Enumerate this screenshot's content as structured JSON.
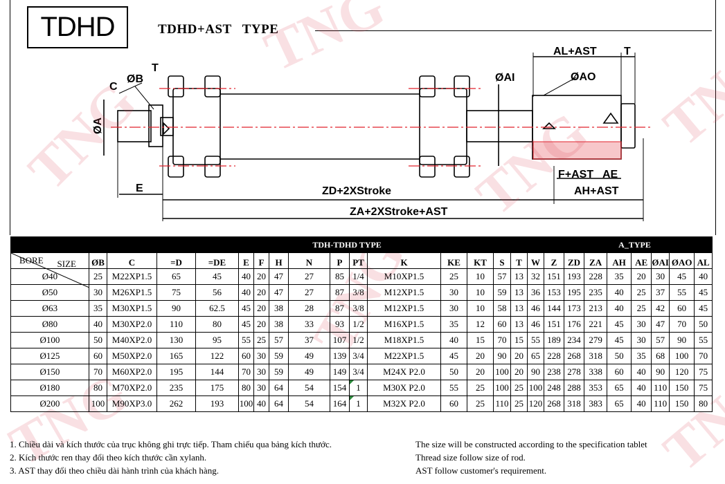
{
  "header": {
    "logo_text": "TDHD",
    "type_title": "TDHD+AST   TYPE"
  },
  "watermark": {
    "text": "TNG",
    "color": "#dc3c50"
  },
  "drawing": {
    "labels": {
      "c": "C",
      "ob": "ØB",
      "t_left": "T",
      "oa": "ØA",
      "e": "E",
      "oai": "ØAI",
      "ao": "ØAO",
      "al_ast": "AL+AST",
      "t_right": "T",
      "f_ast": "F+AST",
      "ae": "AE",
      "ah_ast": "AH+AST",
      "zd": "ZD+2XStroke",
      "za": "ZA+2XStroke+AST"
    },
    "colors": {
      "centerline": "#e0202a",
      "hatch": "#e0202a",
      "outline": "#000000"
    }
  },
  "table": {
    "title": "TDH-TDHD TYPE",
    "right_title": "A_TYPE",
    "corner_size": "SIZE",
    "corner_bore": "BORE",
    "columns": [
      "ØB",
      "C",
      "=D",
      "=DE",
      "E",
      "F",
      "H",
      "N",
      "P",
      "PT",
      "K",
      "KE",
      "KT",
      "S",
      "T",
      "W",
      "Z",
      "ZD",
      "ZA",
      "AH",
      "AE",
      "ØAI",
      "ØAO",
      "AL"
    ],
    "rows": [
      {
        "bore": "Ø40",
        "cells": [
          "25",
          "M22XP1.5",
          "65",
          "45",
          "40",
          "20",
          "47",
          "27",
          "85",
          "1/4",
          "M10XP1.5",
          "25",
          "10",
          "57",
          "13",
          "32",
          "151",
          "193",
          "228",
          "35",
          "20",
          "30",
          "45",
          "40"
        ]
      },
      {
        "bore": "Ø50",
        "cells": [
          "30",
          "M26XP1.5",
          "75",
          "56",
          "40",
          "20",
          "47",
          "27",
          "87",
          "3/8",
          "M12XP1.5",
          "30",
          "10",
          "59",
          "13",
          "36",
          "153",
          "195",
          "235",
          "40",
          "25",
          "37",
          "55",
          "45"
        ]
      },
      {
        "bore": "Ø63",
        "cells": [
          "35",
          "M30XP1.5",
          "90",
          "62.5",
          "45",
          "20",
          "38",
          "28",
          "87",
          "3/8",
          "M12XP1.5",
          "30",
          "10",
          "58",
          "13",
          "46",
          "144",
          "173",
          "213",
          "40",
          "25",
          "42",
          "60",
          "45"
        ]
      },
      {
        "bore": "Ø80",
        "cells": [
          "40",
          "M30XP2.0",
          "110",
          "80",
          "45",
          "20",
          "38",
          "33",
          "93",
          "1/2",
          "M16XP1.5",
          "35",
          "12",
          "60",
          "13",
          "46",
          "151",
          "176",
          "221",
          "45",
          "30",
          "47",
          "70",
          "50"
        ]
      },
      {
        "bore": "Ø100",
        "cells": [
          "50",
          "M40XP2.0",
          "130",
          "95",
          "55",
          "25",
          "57",
          "37",
          "107",
          "1/2",
          "M18XP1.5",
          "40",
          "15",
          "70",
          "15",
          "55",
          "189",
          "234",
          "279",
          "45",
          "30",
          "57",
          "90",
          "55"
        ]
      },
      {
        "bore": "Ø125",
        "cells": [
          "60",
          "M50XP2.0",
          "165",
          "122",
          "60",
          "30",
          "59",
          "49",
          "139",
          "3/4",
          "M22XP1.5",
          "45",
          "20",
          "90",
          "20",
          "65",
          "228",
          "268",
          "318",
          "50",
          "35",
          "68",
          "100",
          "70"
        ]
      },
      {
        "bore": "Ø150",
        "cells": [
          "70",
          "M60XP2.0",
          "195",
          "144",
          "70",
          "30",
          "59",
          "49",
          "149",
          "3/4",
          "M24X P2.0",
          "50",
          "20",
          "100",
          "20",
          "90",
          "238",
          "278",
          "338",
          "60",
          "40",
          "90",
          "120",
          "75"
        ]
      },
      {
        "bore": "Ø180",
        "cells": [
          "80",
          "M70XP2.0",
          "235",
          "175",
          "80",
          "30",
          "64",
          "54",
          "154",
          "1",
          "M30X P2.0",
          "55",
          "25",
          "100",
          "25",
          "100",
          "248",
          "288",
          "353",
          "65",
          "40",
          "110",
          "150",
          "75"
        ]
      },
      {
        "bore": "Ø200",
        "cells": [
          "100",
          "M90XP3.0",
          "262",
          "193",
          "100",
          "40",
          "64",
          "54",
          "164",
          "1",
          "M32X P2.0",
          "60",
          "25",
          "110",
          "25",
          "120",
          "268",
          "318",
          "383",
          "65",
          "40",
          "110",
          "150",
          "80"
        ]
      }
    ]
  },
  "notes": {
    "vi": [
      "1. Chiều dài và kích thước của trục không ghi trực tiếp. Tham chiếu qua bảng kích thước.",
      "2. Kích thước ren thay đổi theo kích thước cần xylanh.",
      "3. AST thay đổi theo chiều dài hành trình của khách hàng."
    ],
    "en": [
      "The size will be constructed according to the specification tablet",
      "Thread size follow size of rod.",
      "AST follow customer's requirement."
    ]
  }
}
